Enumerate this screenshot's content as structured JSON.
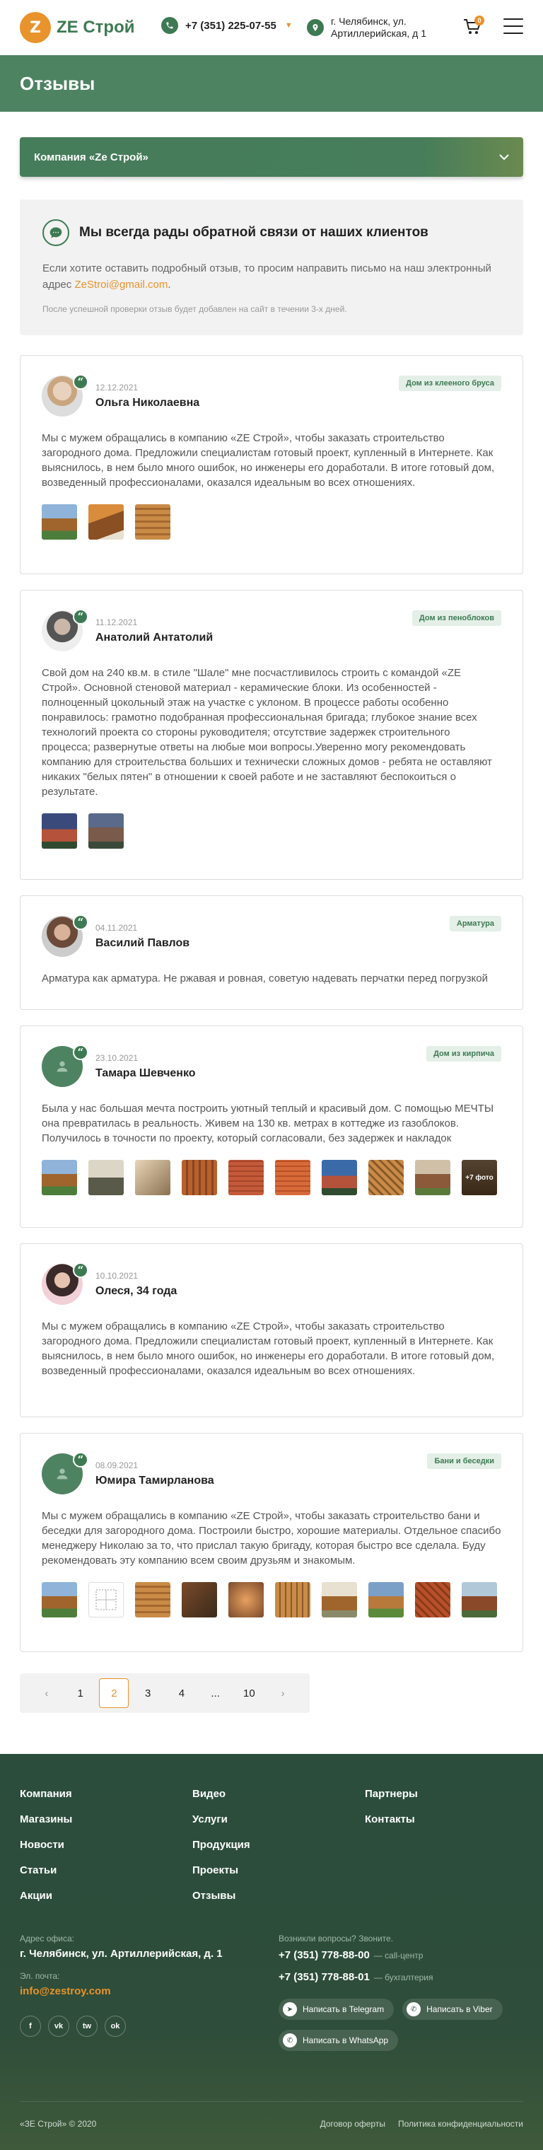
{
  "header": {
    "logo_mark": "Z",
    "logo_text": "ZE Строй",
    "phone": "+7 (351) 225-07-55",
    "address_line1": "г. Челябинск, ул.",
    "address_line2": "Артиллерийская, д 1",
    "cart_count": "0"
  },
  "page_title": "Отзывы",
  "company_select": {
    "value": "Компания «Ze Строй»"
  },
  "info": {
    "title": "Мы всегда рады обратной связи от наших клиентов",
    "text": "Если хотите оставить подробный отзыв, то просим направить письмо на наш электронный адрес ",
    "email": "ZeStroi@gmail.com",
    "note": "После успешной проверки отзыв будет добавлен на сайт в течении 3-х дней."
  },
  "reviews": [
    {
      "date": "12.12.2021",
      "name": "Ольга Николаевна",
      "tag": "Дом из клееного бруса",
      "text": "Мы с мужем обращались в компанию «ZE Строй», чтобы заказать строительство загородного дома. Предложили специалистам готовый проект, купленный в Интернете. Как выяснилось, в нем было много ошибок, но инженеры его доработали. В итоге готовый дом, возведенный профессионалами, оказался идеальным во всех отношениях."
    },
    {
      "date": "11.12.2021",
      "name": "Анатолий Антатолий",
      "tag": "Дом из пеноблоков",
      "text": "Свой дом на 240 кв.м. в стиле \"Шале\" мне посчастливилось строить с командой «ZE Строй». Основной стеновой материал - керамические блоки. Из особенностей - полноценный цокольный этаж на участке с уклоном. В процессе работы особенно понравилось: грамотно подобранная профессиональная бригада; глубокое знание всех технологий проекта со стороны руководителя; отсутствие задержек строительного процесса; развернутые ответы на любые мои вопросы.Уверенно могу рекомендовать компанию для строительства больших и технически сложных домов - ребята не оставляют никаких \"белых пятен\" в отношении к своей работе и не заставляют беспокоиться о результате."
    },
    {
      "date": "04.11.2021",
      "name": "Василий Павлов",
      "tag": "Арматура",
      "text": "Арматура как арматура. Не ржавая и ровная, советую надевать перчатки перед погрузкой"
    },
    {
      "date": "23.10.2021",
      "name": "Тамара Шевченко",
      "tag": "Дом из кирпича",
      "text": "Была у нас большая мечта построить уютный теплый и красивый дом. С помощью МЕЧТЫ она превратилась в реальность. Живем на 130 кв. метрах в коттедже из газоблоков. Получилось в точности по проекту, который согласовали, без задержек и накладок",
      "more_label": "+7 фото"
    },
    {
      "date": "10.10.2021",
      "name": "Олеся, 34 года",
      "tag": "",
      "text": "Мы с мужем обращались в компанию «ZE Строй», чтобы заказать строительство загородного дома. Предложили специалистам готовый проект, купленный в Интернете. Как выяснилось, в нем было много ошибок, но инженеры его доработали. В итоге готовый дом, возведенный профессионалами, оказался идеальным во всех отношениях."
    },
    {
      "date": "08.09.2021",
      "name": "Юмира Тамирланова",
      "tag": "Бани и беседки",
      "text": "Мы с мужем обращались в компанию «ZE Строй», чтобы заказать строительство бани и беседки для загородного дома. Построили быстро, хорошие материалы. Отдельное спасибо менеджеру Николаю за то, что прислал такую бригаду, которая быстро все сделала. Буду рекомендовать эту компанию всем своим друзьям и знакомым."
    }
  ],
  "pagination": {
    "prev": "‹",
    "pages": [
      "1",
      "2",
      "3",
      "4",
      "...",
      "10"
    ],
    "active": "2",
    "next": "›"
  },
  "footer": {
    "nav": [
      "Компания",
      "Видео",
      "Партнеры",
      "Магазины",
      "Услуги",
      "Контакты",
      "Новости",
      "Продукция",
      "",
      "Статьи",
      "Проекты",
      "",
      "Акции",
      "Отзывы",
      ""
    ],
    "address_label": "Адрес офиса:",
    "address": "г. Челябинск, ул. Артиллерийская, д. 1",
    "email_label": "Эл. почта:",
    "email": "info@zestroy.com",
    "questions": "Возникли вопросы? Звоните.",
    "phone1": "+7 (351) 778-88-00",
    "phone1_note": "— call-центр",
    "phone2": "+7 (351) 778-88-01",
    "phone2_note": "— бухгалтерия",
    "telegram": "Написать в Telegram",
    "viber": "Написать в Viber",
    "whatsapp": "Написать в WhatsApp",
    "copyright": "«ЗЕ Строй» © 2020",
    "offer": "Договор оферты",
    "privacy": "Политика конфиденциальности",
    "socials": [
      "f",
      "vk",
      "tw",
      "ok"
    ]
  },
  "colors": {
    "brand_green": "#3d7a53",
    "accent_orange": "#e8932b"
  }
}
